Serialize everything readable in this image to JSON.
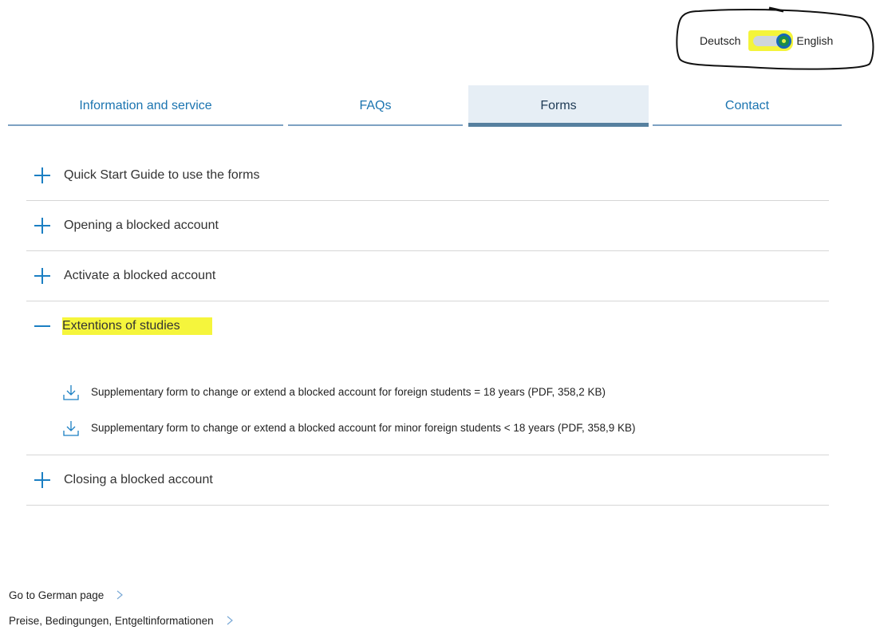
{
  "language_switch": {
    "left_label": "Deutsch",
    "right_label": "English",
    "selected": "English"
  },
  "tabs": [
    {
      "label": "Information and service",
      "active": false
    },
    {
      "label": "FAQs",
      "active": false
    },
    {
      "label": "Forms",
      "active": true
    },
    {
      "label": "Contact",
      "active": false
    }
  ],
  "accordion": [
    {
      "title": "Quick Start Guide to use the forms",
      "expanded": false
    },
    {
      "title": "Opening a blocked account",
      "expanded": false
    },
    {
      "title": "Activate a blocked account",
      "expanded": false
    },
    {
      "title": "Extentions of studies",
      "expanded": true,
      "downloads": [
        "Supplementary form to change or extend a blocked account for foreign students = 18 years (PDF, 358,2 KB)",
        "Supplementary form to change or extend a blocked account for minor foreign students < 18 years (PDF, 358,9 KB)"
      ]
    },
    {
      "title": "Closing a blocked account",
      "expanded": false
    }
  ],
  "footer_links": [
    "Go to German page",
    "Preise, Bedingungen, Entgeltinformationen"
  ],
  "colors": {
    "accent": "#1b7fc3",
    "highlight": "#f5f53c",
    "active_tab_bg": "#e6eef5"
  }
}
